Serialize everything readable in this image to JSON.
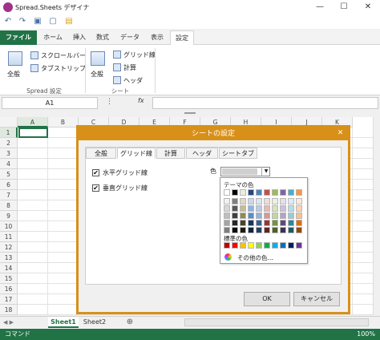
{
  "window": {
    "title": "Spread.Sheets デザイナ",
    "min_glyph": "—",
    "max_glyph": "☐",
    "close_glyph": "✕"
  },
  "qat": {
    "icons": [
      "undo-icon",
      "redo-icon",
      "save-icon",
      "new-icon",
      "open-icon"
    ],
    "glyphs": [
      "↶",
      "↷",
      "▣",
      "▢",
      "▤"
    ]
  },
  "ribbon": {
    "tabs": [
      "ファイル",
      "ホーム",
      "挿入",
      "数式",
      "データ",
      "表示",
      "設定"
    ],
    "active_tab": "設定",
    "groups": {
      "spread": {
        "label": "Spread 設定",
        "general": "全般",
        "scrollbar": "スクロールバー",
        "tabstrip": "タブストリップ"
      },
      "sheet": {
        "label": "シート",
        "general": "全般",
        "gridlines": "グリッド線",
        "calc": "計算",
        "headers": "ヘッダ"
      }
    }
  },
  "formula_bar": {
    "namebox": "A1",
    "menu_glyph": "⋮",
    "fx": "fx",
    "value": ""
  },
  "grid": {
    "columns": [
      "A",
      "B",
      "C",
      "D",
      "E",
      "F",
      "G",
      "H",
      "I",
      "J",
      "K",
      "L"
    ],
    "rows": [
      "1",
      "2",
      "3",
      "4",
      "5",
      "6",
      "7",
      "8",
      "9",
      "10",
      "11",
      "12",
      "13",
      "14",
      "15",
      "16",
      "17",
      "18"
    ],
    "selected_cell": "A1"
  },
  "dialog": {
    "title": "シートの設定",
    "close_glyph": "✕",
    "tabs": [
      "全般",
      "グリッド線",
      "計算",
      "ヘッダ",
      "シートタブ"
    ],
    "active_tab": "グリッド線",
    "horizontal_gridlines": {
      "label": "水平グリッド線",
      "checked": true
    },
    "vertical_gridlines": {
      "label": "垂直グリッド線",
      "checked": true
    },
    "color_label": "色",
    "color_combo_arrow": "▼",
    "ok": "OK",
    "cancel": "キャンセル"
  },
  "color_picker": {
    "theme_label": "テーマの色",
    "standard_label": "標準の色",
    "more_colors": "その他の色...",
    "theme_top": [
      "#ffffff",
      "#000000",
      "#eeece1",
      "#1f497d",
      "#4f81bd",
      "#c0504d",
      "#9bbb59",
      "#8064a2",
      "#4bacc6",
      "#f79646"
    ],
    "theme_shades": [
      [
        "#f2f2f2",
        "#7f7f7f",
        "#ddd9c3",
        "#c6d9f0",
        "#dbe5f1",
        "#f2dcdb",
        "#ebf1dd",
        "#e5e0ec",
        "#dbeef3",
        "#fdeada"
      ],
      [
        "#d8d8d8",
        "#595959",
        "#c4bd97",
        "#8db3e2",
        "#b8cce4",
        "#e5b9b7",
        "#d7e3bc",
        "#ccc1d9",
        "#b7dde8",
        "#fbd5b5"
      ],
      [
        "#bfbfbf",
        "#3f3f3f",
        "#938953",
        "#548dd4",
        "#95b3d7",
        "#d99694",
        "#c3d69b",
        "#b2a2c7",
        "#92cddc",
        "#fac08f"
      ],
      [
        "#a5a5a5",
        "#262626",
        "#494429",
        "#17365d",
        "#366092",
        "#953734",
        "#76923c",
        "#5f497a",
        "#31859b",
        "#e36c09"
      ],
      [
        "#7f7f7f",
        "#0c0c0c",
        "#1d1b10",
        "#0f243e",
        "#244061",
        "#632423",
        "#4f6128",
        "#3f3151",
        "#205867",
        "#974806"
      ]
    ],
    "standard": [
      "#c00000",
      "#ff0000",
      "#ffc000",
      "#ffff00",
      "#92d050",
      "#00b050",
      "#00b0f0",
      "#0070c0",
      "#002060",
      "#7030a0"
    ]
  },
  "sheets": {
    "tabs": [
      "Sheet1",
      "Sheet2"
    ],
    "active": "Sheet1",
    "add_glyph": "⊕"
  },
  "status": {
    "left": "コマンド",
    "zoom": "100%"
  },
  "colors": {
    "accent_green": "#217346",
    "dialog_orange": "#d89019"
  }
}
